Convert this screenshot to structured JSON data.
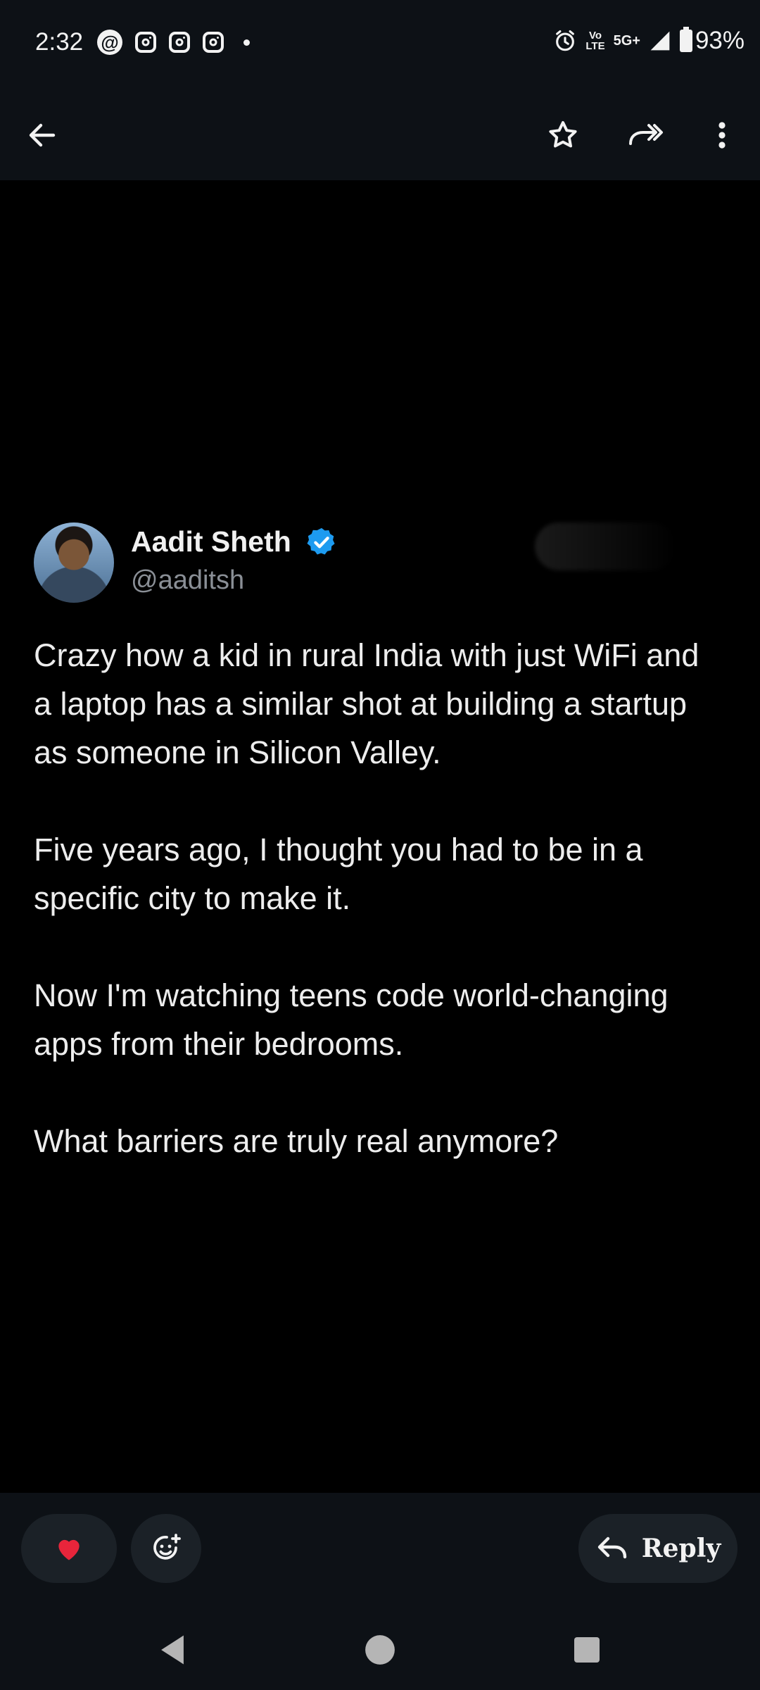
{
  "status_bar": {
    "time": "2:32",
    "left_icons": [
      "threads-icon",
      "instagram-icon",
      "instagram-icon",
      "instagram-icon",
      "dot-icon"
    ],
    "right_icons": [
      "alarm-icon",
      "volte-icon",
      "5g-icon",
      "signal-icon",
      "battery-icon"
    ],
    "volte_label_top": "Vo",
    "volte_label_bottom": "LTE",
    "network_label": "5G+",
    "battery": "93%"
  },
  "app_bar": {
    "back_icon": "arrow-left-icon",
    "star_icon": "star-outline-icon",
    "forward_icon": "forward-icon",
    "more_icon": "more-vertical-icon"
  },
  "tweet": {
    "author_name": "Aadit Sheth",
    "handle": "@aaditsh",
    "verified": true,
    "paragraphs": [
      "Crazy how a kid in rural India with just WiFi and a laptop has a similar shot at building a startup as someone in Silicon Valley.",
      "Five years ago, I thought you had to be in a specific city to make it.",
      "Now I'm watching teens code world-changing apps from their bedrooms.",
      "What barriers are truly real anymore?"
    ]
  },
  "actions": {
    "heart_icon": "heart-icon",
    "emoji_icon": "add-emoji-icon",
    "reply_label": "Reply",
    "reply_icon": "reply-arrow-icon"
  },
  "colors": {
    "background": "#000000",
    "bar_background": "#0d1116",
    "pill_background": "#1b2127",
    "verified_blue": "#1d9bf0",
    "heart_red": "#e8253b",
    "handle_gray": "#8a8f96"
  }
}
